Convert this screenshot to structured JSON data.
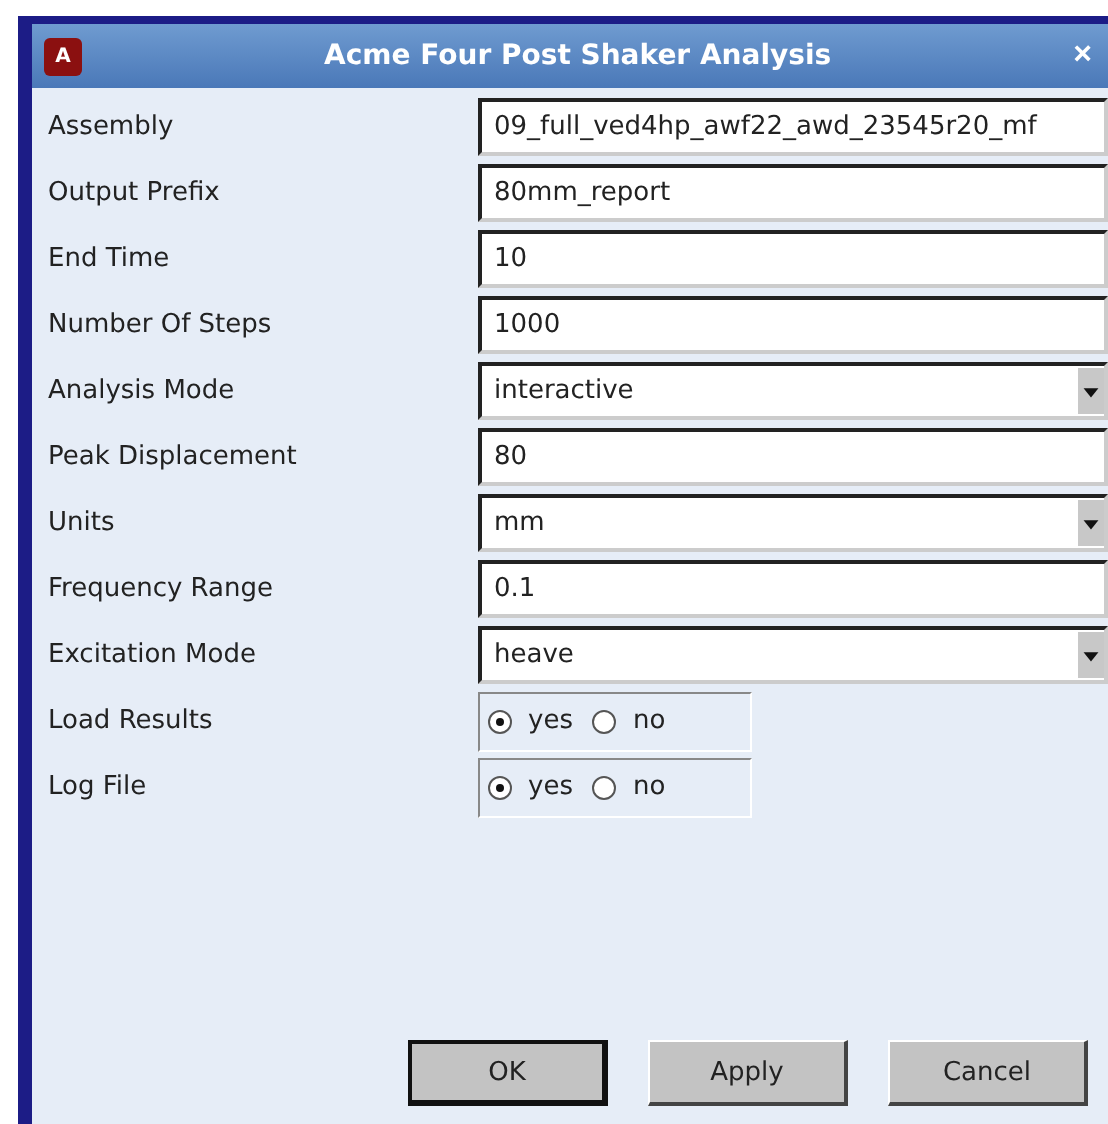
{
  "window": {
    "title": "Acme Four Post Shaker Analysis",
    "logo": "A",
    "close": "×"
  },
  "fields": [
    {
      "kind": "text",
      "label": "Assembly",
      "value": "09_full_ved4hp_awf22_awd_23545r20_mf"
    },
    {
      "kind": "text",
      "label": "Output Prefix",
      "value": "80mm_report"
    },
    {
      "kind": "text",
      "label": "End Time",
      "value": "10"
    },
    {
      "kind": "text",
      "label": "Number Of Steps",
      "value": "1000"
    },
    {
      "kind": "dropdown",
      "label": "Analysis Mode",
      "value": "interactive"
    },
    {
      "kind": "text",
      "label": "Peak Displacement",
      "value": "80"
    },
    {
      "kind": "dropdown",
      "label": "Units",
      "value": "mm"
    },
    {
      "kind": "text",
      "label": "Frequency Range",
      "value": "0.1"
    },
    {
      "kind": "dropdown",
      "label": "Excitation Mode",
      "value": "heave"
    },
    {
      "kind": "radio",
      "label": "Load Results",
      "options": [
        {
          "label": "yes",
          "selected": true
        },
        {
          "label": "no",
          "selected": false
        }
      ]
    },
    {
      "kind": "radio",
      "label": "Log File",
      "options": [
        {
          "label": "yes",
          "selected": true
        },
        {
          "label": "no",
          "selected": false
        }
      ]
    }
  ],
  "buttons": [
    {
      "label": "OK",
      "default": true
    },
    {
      "label": "Apply",
      "default": false
    },
    {
      "label": "Cancel",
      "default": false
    }
  ]
}
